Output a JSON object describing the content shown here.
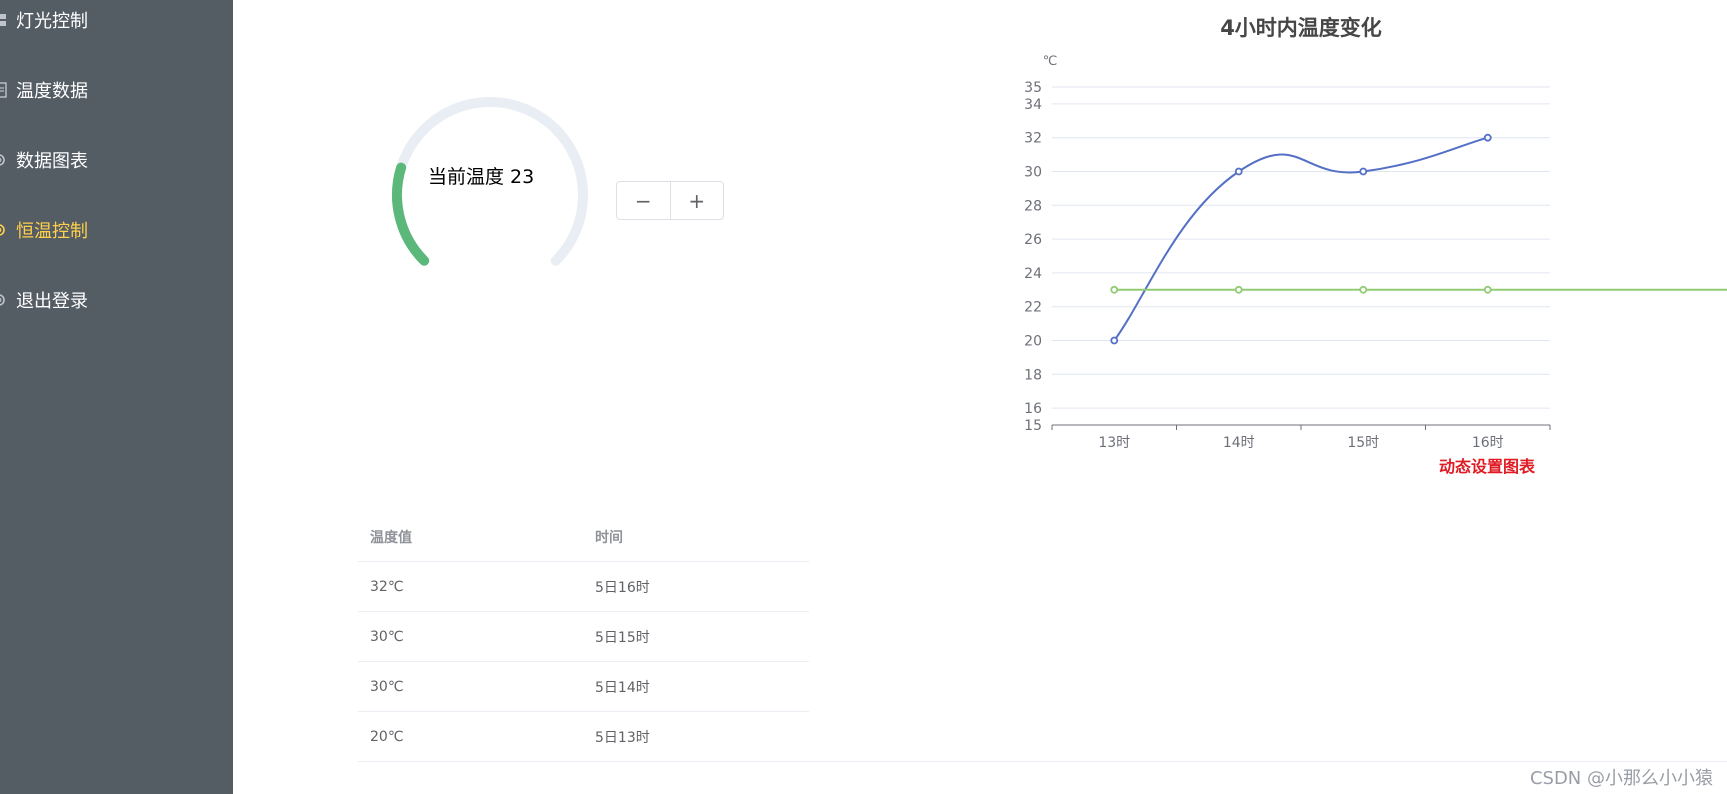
{
  "sidebar": {
    "bg_color": "#545c64",
    "active_color": "#ffd04b",
    "items": [
      {
        "label": "灯光控制",
        "icon": "menu-icon",
        "active": false
      },
      {
        "label": "温度数据",
        "icon": "document-icon",
        "active": false
      },
      {
        "label": "数据图表",
        "icon": "gear-icon",
        "active": false
      },
      {
        "label": "恒温控制",
        "icon": "gear-icon",
        "active": true
      },
      {
        "label": "退出登录",
        "icon": "gear-icon",
        "active": false
      }
    ]
  },
  "gauge": {
    "label": "当前温度 23",
    "value": 23,
    "fill_color": "#5cb87a",
    "track_color": "#e9edf4"
  },
  "stepper": {
    "minus": "−",
    "plus": "+"
  },
  "chart_data": {
    "type": "line",
    "title": "4小时内温度变化",
    "ylabel": "℃",
    "xlabel": "",
    "categories": [
      "13时",
      "14时",
      "15时",
      "16时"
    ],
    "ylim": [
      15,
      35
    ],
    "yticks": [
      15,
      16,
      18,
      20,
      22,
      24,
      26,
      28,
      30,
      32,
      34,
      35
    ],
    "series": [
      {
        "values": [
          20,
          30,
          30,
          32
        ],
        "color": "#5470c6"
      },
      {
        "values": [
          23,
          23,
          23,
          23
        ],
        "color": "#91cc75"
      }
    ],
    "grid": true,
    "annotation": "动态设置图表",
    "annotation_color": "#e01b24"
  },
  "table": {
    "headers": [
      "温度值",
      "时间"
    ],
    "rows": [
      [
        "32℃",
        "5日16时"
      ],
      [
        "30℃",
        "5日15时"
      ],
      [
        "30℃",
        "5日14时"
      ],
      [
        "20℃",
        "5日13时"
      ]
    ]
  },
  "watermark": "CSDN @小那么小小猿"
}
